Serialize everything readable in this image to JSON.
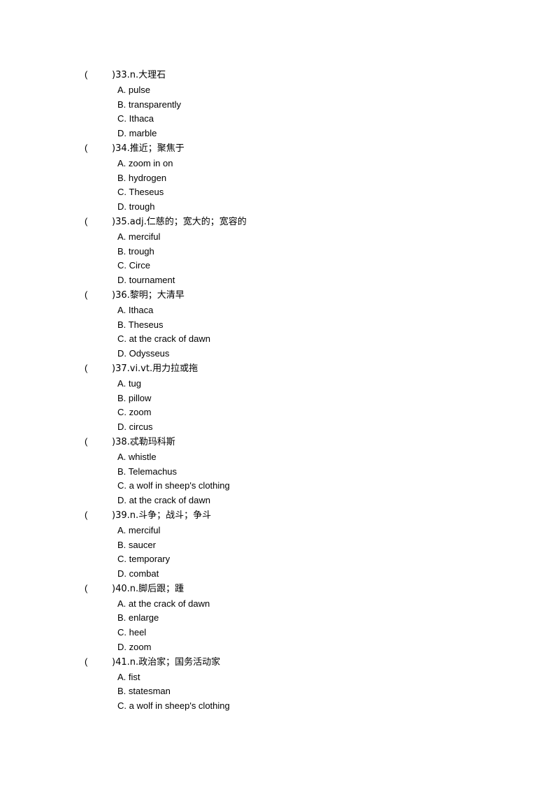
{
  "document": {
    "page_background": "#ffffff",
    "text_color": "#000000",
    "questions": [
      {
        "marker_open": "(",
        "marker_close": ")",
        "number": "33.",
        "pos": "n.",
        "prompt": "大理石",
        "stem": ")33.n.大理石",
        "options": [
          {
            "letter": "A.",
            "text": "pulse",
            "full": "A. pulse"
          },
          {
            "letter": "B.",
            "text": "transparently",
            "full": "B. transparently"
          },
          {
            "letter": "C.",
            "text": "Ithaca",
            "full": "C. Ithaca"
          },
          {
            "letter": "D.",
            "text": "marble",
            "full": "D. marble"
          }
        ]
      },
      {
        "marker_open": "(",
        "marker_close": ")",
        "number": "34.",
        "pos": "",
        "prompt": "推近；聚焦于",
        "stem": ")34.推近；聚焦于",
        "options": [
          {
            "letter": "A.",
            "text": "zoom in on",
            "full": "A. zoom in on"
          },
          {
            "letter": "B.",
            "text": "hydrogen",
            "full": "B. hydrogen"
          },
          {
            "letter": "C.",
            "text": "Theseus",
            "full": "C. Theseus"
          },
          {
            "letter": "D.",
            "text": "trough",
            "full": "D. trough"
          }
        ]
      },
      {
        "marker_open": "(",
        "marker_close": ")",
        "number": "35.",
        "pos": "adj.",
        "prompt": "仁慈的；宽大的；宽容的",
        "stem": ")35.adj.仁慈的；宽大的；宽容的",
        "options": [
          {
            "letter": "A.",
            "text": "merciful",
            "full": "A. merciful"
          },
          {
            "letter": "B.",
            "text": "trough",
            "full": "B. trough"
          },
          {
            "letter": "C.",
            "text": "Circe",
            "full": "C. Circe"
          },
          {
            "letter": "D.",
            "text": "tournament",
            "full": "D. tournament"
          }
        ]
      },
      {
        "marker_open": "(",
        "marker_close": ")",
        "number": "36.",
        "pos": "",
        "prompt": "黎明；大清早",
        "stem": ")36.黎明；大清早",
        "options": [
          {
            "letter": "A.",
            "text": "Ithaca",
            "full": "A. Ithaca"
          },
          {
            "letter": "B.",
            "text": "Theseus",
            "full": "B. Theseus"
          },
          {
            "letter": "C.",
            "text": "at the crack of dawn",
            "full": "C. at the crack of dawn"
          },
          {
            "letter": "D.",
            "text": "Odysseus",
            "full": "D. Odysseus"
          }
        ]
      },
      {
        "marker_open": "(",
        "marker_close": ")",
        "number": "37.",
        "pos": "vi.vt.",
        "prompt": "用力拉或拖",
        "stem": ")37.vi.vt.用力拉或拖",
        "options": [
          {
            "letter": "A.",
            "text": "tug",
            "full": "A. tug"
          },
          {
            "letter": "B.",
            "text": "pillow",
            "full": "B. pillow"
          },
          {
            "letter": "C.",
            "text": "zoom",
            "full": "C. zoom"
          },
          {
            "letter": "D.",
            "text": "circus",
            "full": "D. circus"
          }
        ]
      },
      {
        "marker_open": "(",
        "marker_close": ")",
        "number": "38.",
        "pos": "",
        "prompt": "忒勒玛科斯",
        "stem": ")38.忒勒玛科斯",
        "options": [
          {
            "letter": "A.",
            "text": "whistle",
            "full": "A. whistle"
          },
          {
            "letter": "B.",
            "text": "Telemachus",
            "full": "B. Telemachus"
          },
          {
            "letter": "C.",
            "text": "a wolf in sheep's clothing",
            "full": "C. a wolf in sheep's clothing"
          },
          {
            "letter": "D.",
            "text": "at the crack of dawn",
            "full": "D. at the crack of dawn"
          }
        ]
      },
      {
        "marker_open": "(",
        "marker_close": ")",
        "number": "39.",
        "pos": "n.",
        "prompt": "斗争；战斗；争斗",
        "stem": ")39.n.斗争；战斗；争斗",
        "options": [
          {
            "letter": "A.",
            "text": "merciful",
            "full": "A. merciful"
          },
          {
            "letter": "B.",
            "text": "saucer",
            "full": "B. saucer"
          },
          {
            "letter": "C.",
            "text": "temporary",
            "full": "C. temporary"
          },
          {
            "letter": "D.",
            "text": "combat",
            "full": "D. combat"
          }
        ]
      },
      {
        "marker_open": "(",
        "marker_close": ")",
        "number": "40.",
        "pos": "n.",
        "prompt": "脚后跟；踵",
        "stem": ")40.n.脚后跟；踵",
        "options": [
          {
            "letter": "A.",
            "text": "at the crack of dawn",
            "full": "A. at the crack of dawn"
          },
          {
            "letter": "B.",
            "text": "enlarge",
            "full": "B. enlarge"
          },
          {
            "letter": "C.",
            "text": "heel",
            "full": "C. heel"
          },
          {
            "letter": "D.",
            "text": "zoom",
            "full": "D. zoom"
          }
        ]
      },
      {
        "marker_open": "(",
        "marker_close": ")",
        "number": "41.",
        "pos": "n.",
        "prompt": "政治家；国务活动家",
        "stem": ")41.n.政治家；国务活动家",
        "options": [
          {
            "letter": "A.",
            "text": "fist",
            "full": "A. fist"
          },
          {
            "letter": "B.",
            "text": "statesman",
            "full": "B. statesman"
          },
          {
            "letter": "C.",
            "text": "a wolf in sheep's clothing",
            "full": "C. a wolf in sheep's clothing"
          }
        ]
      }
    ]
  }
}
